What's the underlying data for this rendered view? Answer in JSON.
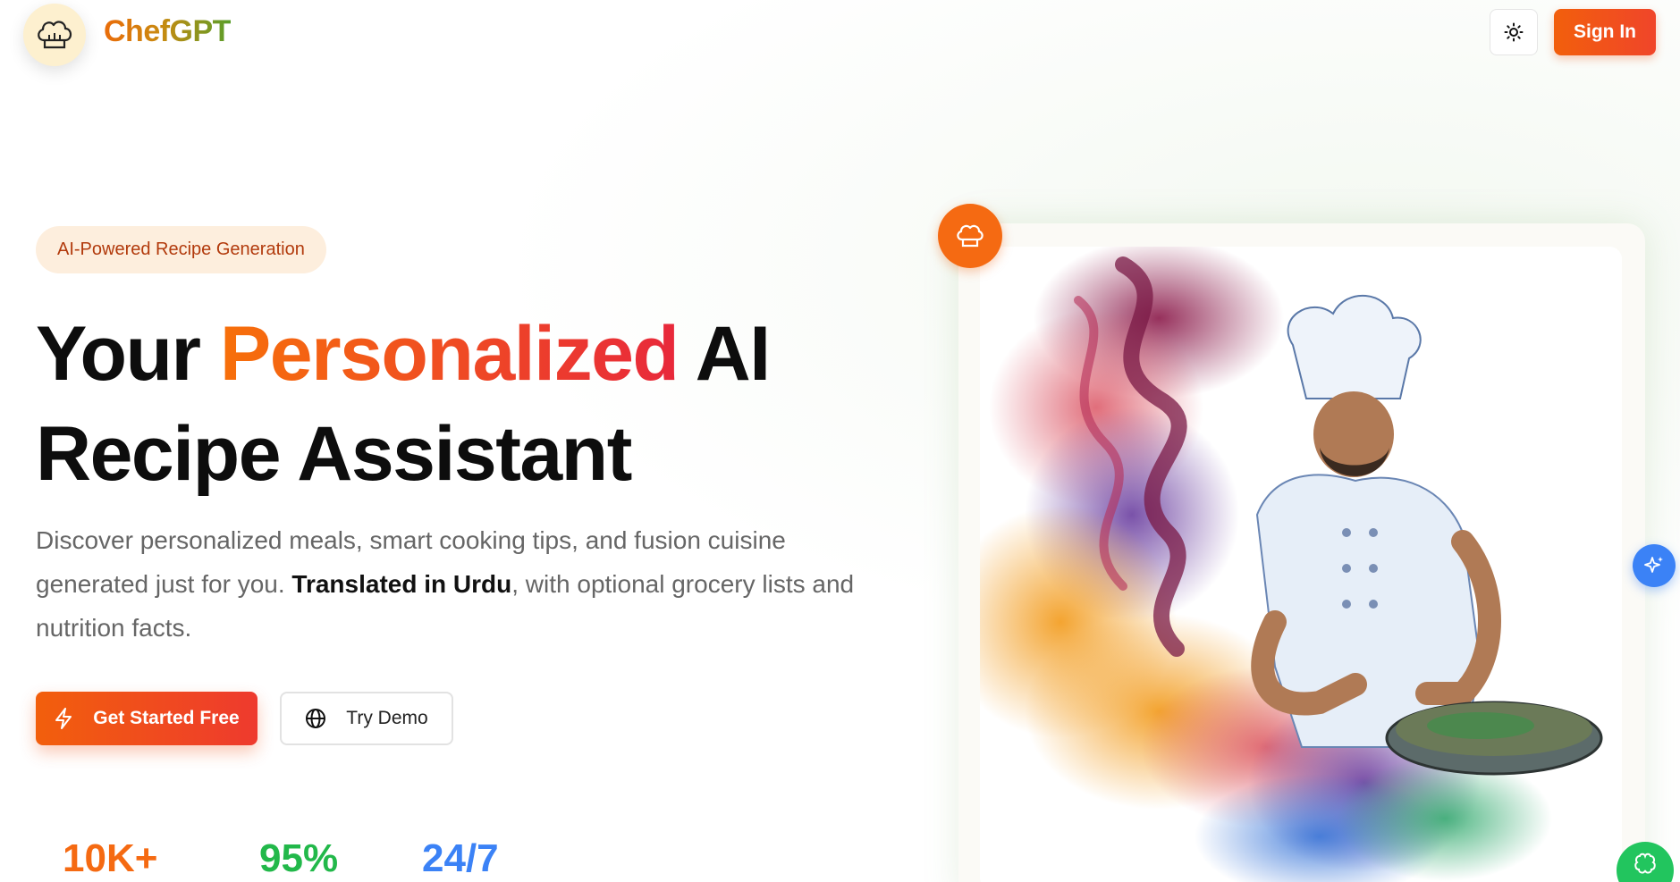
{
  "header": {
    "brand": "ChefGPT",
    "logo_icon": "chef-hat-icon",
    "theme_icon": "sun-icon",
    "sign_in_label": "Sign In"
  },
  "hero": {
    "badge": "AI-Powered Recipe Generation",
    "headline_part1": "Your ",
    "headline_accent": "Personalized",
    "headline_part2": " AI Recipe Assistant",
    "subtext_part1": "Discover personalized meals, smart cooking tips, and fusion cuisine generated just for you. ",
    "subtext_strong": "Translated in Urdu",
    "subtext_part2": ", with optional grocery lists and nutrition facts.",
    "primary_cta": "Get Started Free",
    "primary_cta_icon": "lightning-icon",
    "secondary_cta": "Try Demo",
    "secondary_cta_icon": "globe-icon"
  },
  "stats": [
    {
      "value": "10K+",
      "color": "#f56a12"
    },
    {
      "value": "95%",
      "color": "#22b84a"
    },
    {
      "value": "24/7",
      "color": "#3b82f6"
    }
  ],
  "image": {
    "badge_icon": "chef-hat-icon",
    "ai_button_icon": "sparkles-icon",
    "chat_button_icon": "brain-icon"
  },
  "colors": {
    "accent_orange": "#f25f0c",
    "accent_red": "#e8283b",
    "badge_bg": "#fdeedd"
  }
}
